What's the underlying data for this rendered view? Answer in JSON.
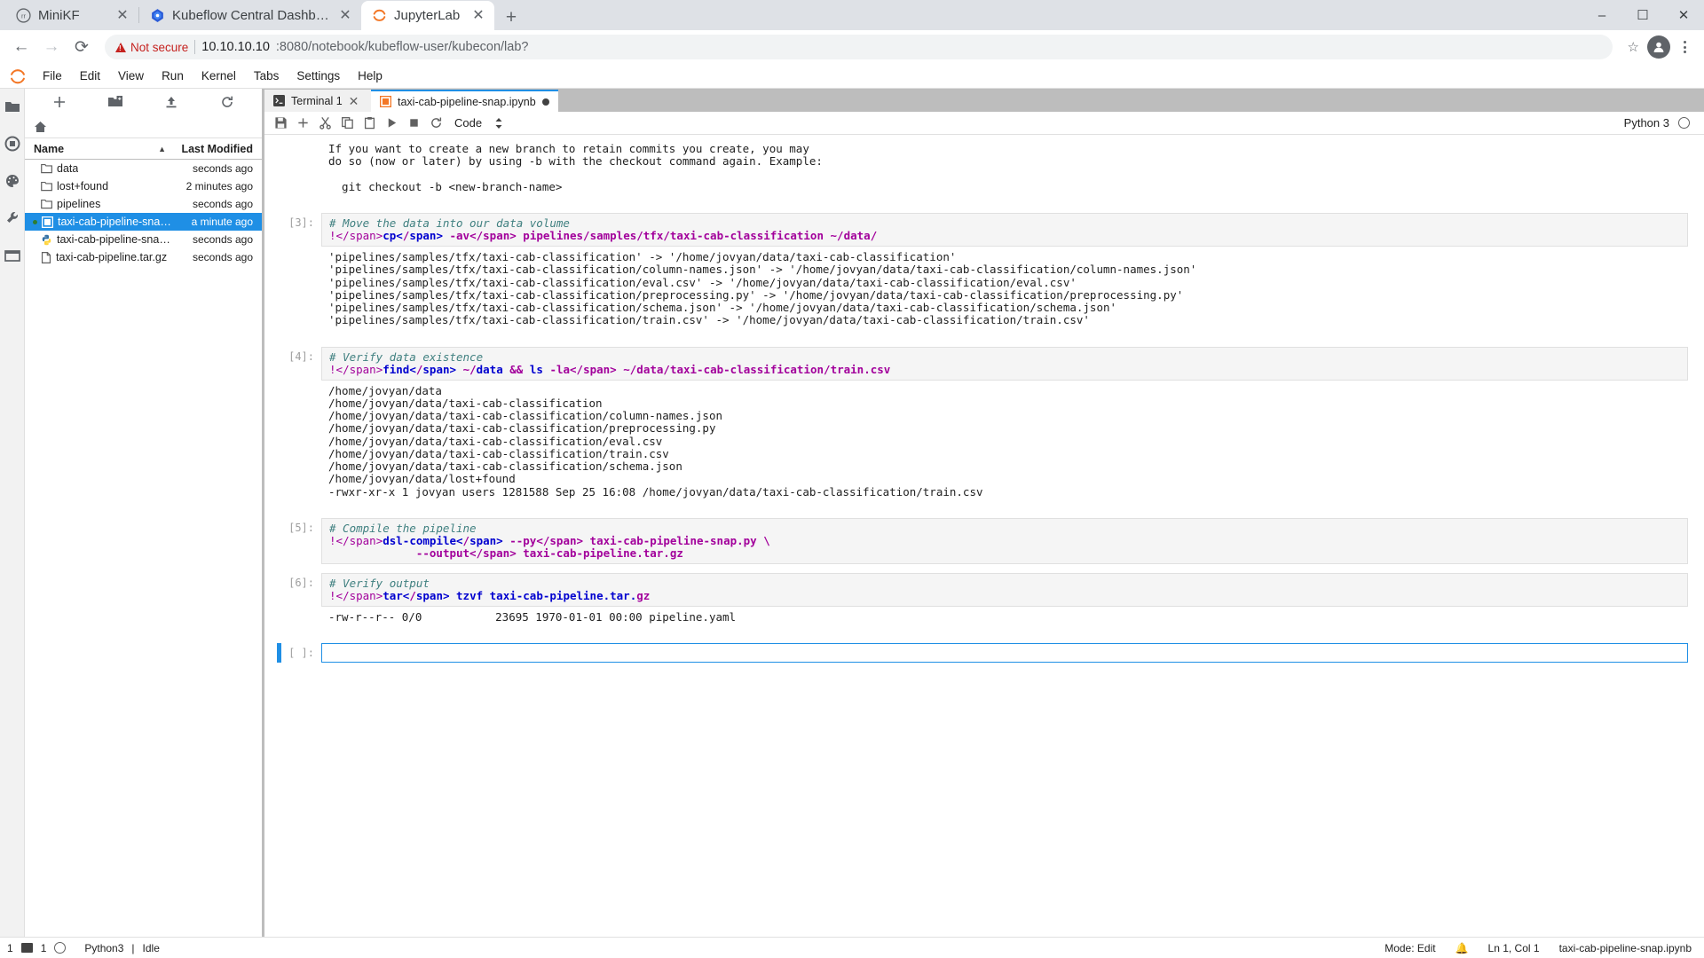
{
  "browser": {
    "tabs": [
      {
        "title": "MiniKF",
        "icon": "minikf-icon",
        "active": false,
        "closable": true
      },
      {
        "title": "Kubeflow Central Dashboard",
        "icon": "kubeflow-icon",
        "active": false,
        "closable": true
      },
      {
        "title": "JupyterLab",
        "icon": "jupyter-icon",
        "active": true,
        "closable": true
      }
    ],
    "new_tab_label": "+",
    "window_controls": {
      "minimize": "–",
      "maximize": "☐",
      "close": "✕"
    },
    "nav": {
      "back": "←",
      "forward": "→",
      "reload": "⟳"
    },
    "security_label": "Not secure",
    "url_host": "10.10.10.10",
    "url_rest": ":8080/notebook/kubeflow-user/kubecon/lab?",
    "bookmark_label": "☆"
  },
  "jupyter": {
    "menu": [
      "File",
      "Edit",
      "View",
      "Run",
      "Kernel",
      "Tabs",
      "Settings",
      "Help"
    ],
    "sidebar_icons": [
      {
        "name": "file-browser-icon",
        "glyph": "folder"
      },
      {
        "name": "running-terminals-icon",
        "glyph": "stop"
      },
      {
        "name": "commands-palette-icon",
        "glyph": "palette"
      },
      {
        "name": "extension-manager-icon",
        "glyph": "wrench"
      },
      {
        "name": "open-tabs-icon",
        "glyph": "tabs"
      }
    ],
    "filebrowser": {
      "toolbar": [
        {
          "name": "new-launcher-button",
          "glyph": "+"
        },
        {
          "name": "new-folder-button",
          "glyph": "folder-plus"
        },
        {
          "name": "upload-button",
          "glyph": "upload"
        },
        {
          "name": "refresh-button",
          "glyph": "refresh"
        }
      ],
      "breadcrumb_home": "home-icon",
      "columns": {
        "name": "Name",
        "modified": "Last Modified"
      },
      "sort_indicator": "▲",
      "items": [
        {
          "name": "data",
          "modified": "seconds ago",
          "type": "folder",
          "selected": false,
          "running": false
        },
        {
          "name": "lost+found",
          "modified": "2 minutes ago",
          "type": "folder",
          "selected": false,
          "running": false
        },
        {
          "name": "pipelines",
          "modified": "seconds ago",
          "type": "folder",
          "selected": false,
          "running": false
        },
        {
          "name": "taxi-cab-pipeline-snap.ip...",
          "modified": "a minute ago",
          "type": "notebook",
          "selected": true,
          "running": true
        },
        {
          "name": "taxi-cab-pipeline-snap.py",
          "modified": "seconds ago",
          "type": "python",
          "selected": false,
          "running": false
        },
        {
          "name": "taxi-cab-pipeline.tar.gz",
          "modified": "seconds ago",
          "type": "archive",
          "selected": false,
          "running": false
        }
      ]
    },
    "dock_tabs": [
      {
        "label": "Terminal 1",
        "icon": "terminal-icon",
        "active": false,
        "dirty": false
      },
      {
        "label": "taxi-cab-pipeline-snap.ipynb",
        "icon": "notebook-icon",
        "active": true,
        "dirty": true
      }
    ],
    "notebook_toolbar": {
      "buttons": [
        {
          "name": "save-button",
          "glyph": "save"
        },
        {
          "name": "insert-cell-button",
          "glyph": "plus"
        },
        {
          "name": "cut-cell-button",
          "glyph": "scissors"
        },
        {
          "name": "copy-cell-button",
          "glyph": "copy"
        },
        {
          "name": "paste-cell-button",
          "glyph": "clipboard"
        },
        {
          "name": "run-cell-button",
          "glyph": "play"
        },
        {
          "name": "interrupt-kernel-button",
          "glyph": "stop"
        },
        {
          "name": "restart-kernel-button",
          "glyph": "refresh"
        }
      ],
      "cell_type": "Code",
      "kernel_name": "Python 3",
      "kernel_status": "idle"
    },
    "cells": [
      {
        "prompt": "",
        "type": "markdown-output-tail",
        "code": "",
        "output": "If you want to create a new branch to retain commits you create, you may\ndo so (now or later) by using -b with the checkout command again. Example:\n\n  git checkout -b <new-branch-name>"
      },
      {
        "prompt": "[3]:",
        "type": "code",
        "comment": "# Move the data into our data volume",
        "code": "!cp -av pipelines/samples/tfx/taxi-cab-classification ~/data/",
        "output": "'pipelines/samples/tfx/taxi-cab-classification' -> '/home/jovyan/data/taxi-cab-classification'\n'pipelines/samples/tfx/taxi-cab-classification/column-names.json' -> '/home/jovyan/data/taxi-cab-classification/column-names.json'\n'pipelines/samples/tfx/taxi-cab-classification/eval.csv' -> '/home/jovyan/data/taxi-cab-classification/eval.csv'\n'pipelines/samples/tfx/taxi-cab-classification/preprocessing.py' -> '/home/jovyan/data/taxi-cab-classification/preprocessing.py'\n'pipelines/samples/tfx/taxi-cab-classification/schema.json' -> '/home/jovyan/data/taxi-cab-classification/schema.json'\n'pipelines/samples/tfx/taxi-cab-classification/train.csv' -> '/home/jovyan/data/taxi-cab-classification/train.csv'"
      },
      {
        "prompt": "[4]:",
        "type": "code",
        "comment": "# Verify data existence",
        "code": "!find ~/data && ls -la ~/data/taxi-cab-classification/train.csv",
        "output": "/home/jovyan/data\n/home/jovyan/data/taxi-cab-classification\n/home/jovyan/data/taxi-cab-classification/column-names.json\n/home/jovyan/data/taxi-cab-classification/preprocessing.py\n/home/jovyan/data/taxi-cab-classification/eval.csv\n/home/jovyan/data/taxi-cab-classification/train.csv\n/home/jovyan/data/taxi-cab-classification/schema.json\n/home/jovyan/data/lost+found\n-rwxr-xr-x 1 jovyan users 1281588 Sep 25 16:08 /home/jovyan/data/taxi-cab-classification/train.csv"
      },
      {
        "prompt": "[5]:",
        "type": "code",
        "comment": "# Compile the pipeline",
        "code": "!dsl-compile --py taxi-cab-pipeline-snap.py \\\n             --output taxi-cab-pipeline.tar.gz",
        "output": ""
      },
      {
        "prompt": "[6]:",
        "type": "code",
        "comment": "# Verify output",
        "code": "!tar tzvf taxi-cab-pipeline.tar.gz",
        "output": "-rw-r--r-- 0/0           23695 1970-01-01 00:00 pipeline.yaml"
      },
      {
        "prompt": "[ ]:",
        "type": "empty-active",
        "code": "",
        "output": ""
      }
    ],
    "statusbar": {
      "terminal_count": "1",
      "kernel_count": "1",
      "kernel_label": "Python3",
      "kernel_state": "Idle",
      "mode": "Mode: Edit",
      "cursor": "Ln 1, Col 1",
      "filename": "taxi-cab-pipeline-snap.ipynb"
    }
  },
  "colors": {
    "accent": "#1f8fe5",
    "jupyter_orange": "#f37726",
    "warning": "#c5221f",
    "chrome_bg": "#dee1e6"
  }
}
